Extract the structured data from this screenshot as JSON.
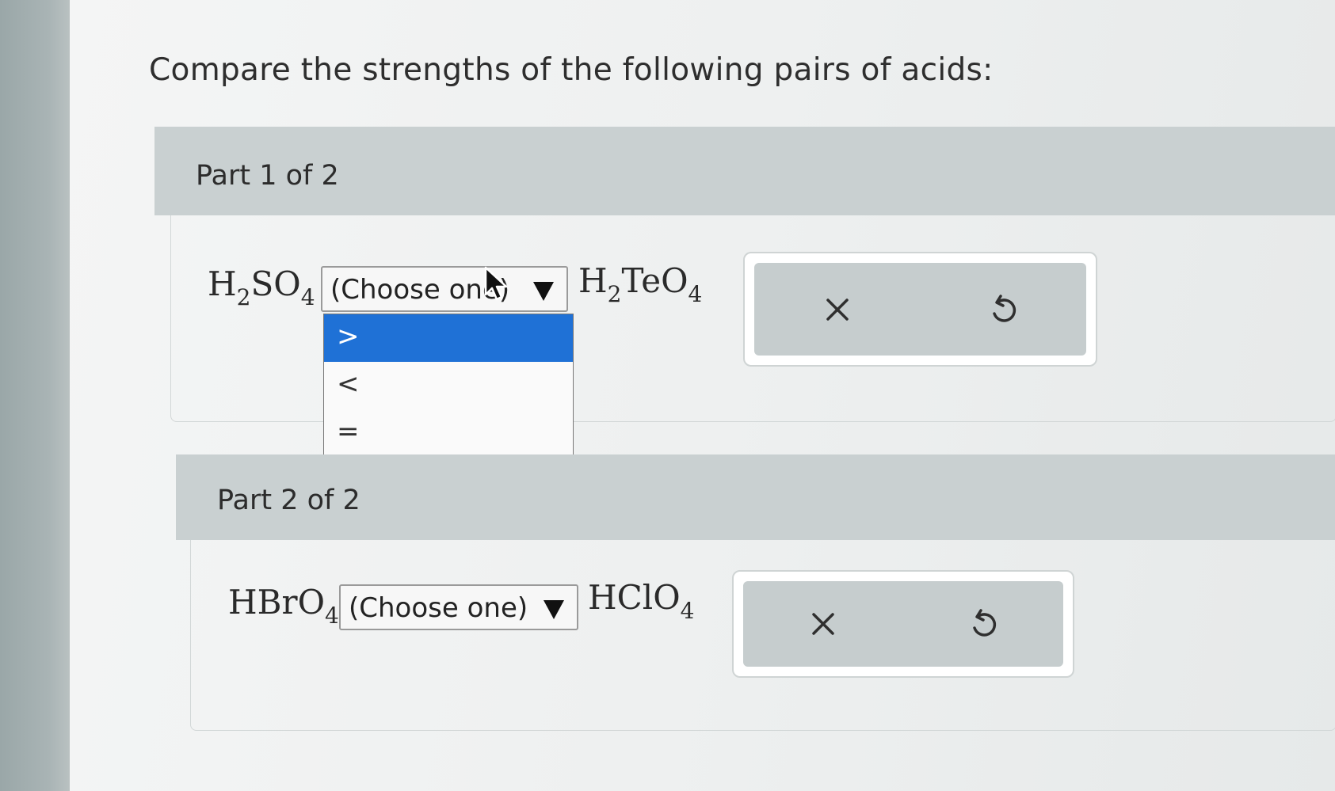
{
  "question": {
    "text": "Compare the strengths of the following pairs of acids:"
  },
  "part1": {
    "header": "Part 1 of 2",
    "left_formula": {
      "a": "H",
      "a_sub": "2",
      "b": "SO",
      "b_sub": "4"
    },
    "select_value": "(Choose one)",
    "right_formula": {
      "a": "H",
      "a_sub": "2",
      "b": "TeO",
      "b_sub": "4"
    },
    "dropdown_options": [
      ">",
      "<",
      "="
    ],
    "dropdown_selected_index": 0
  },
  "part2": {
    "header": "Part 2 of 2",
    "left_formula": {
      "a": "HBrO",
      "a_sub": "4"
    },
    "select_value": "(Choose one)",
    "right_formula": {
      "a": "HClO",
      "a_sub": "4"
    }
  },
  "icons": {
    "clear": "x-icon",
    "undo": "undo-icon",
    "dropdown": "triangle-down-icon",
    "cursor": "mouse-pointer-icon"
  },
  "colors": {
    "header_bg": "#c9d0d1",
    "selected_option": "#1f71d6",
    "button_bg": "#c6cdce"
  }
}
